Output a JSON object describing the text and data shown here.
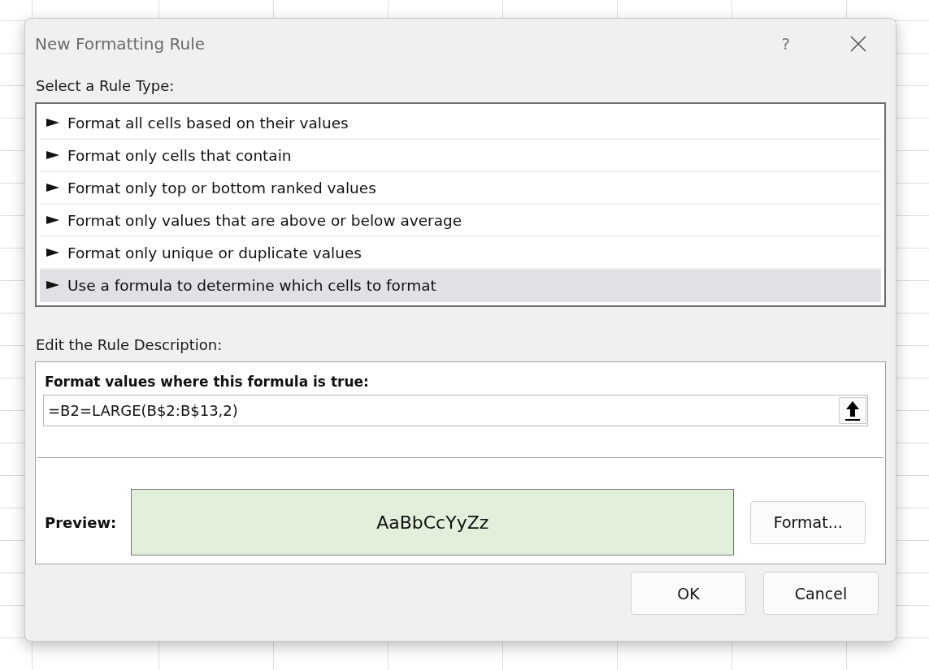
{
  "window": {
    "title": "New Formatting Rule",
    "help": "?"
  },
  "rule_type": {
    "label": "Select a Rule Type:",
    "items": [
      {
        "label": "Format all cells based on their values",
        "selected": false
      },
      {
        "label": "Format only cells that contain",
        "selected": false
      },
      {
        "label": "Format only top or bottom ranked values",
        "selected": false
      },
      {
        "label": "Format only values that are above or below average",
        "selected": false
      },
      {
        "label": "Format only unique or duplicate values",
        "selected": false
      },
      {
        "label": "Use a formula to determine which cells to format",
        "selected": true
      }
    ]
  },
  "description": {
    "label": "Edit the Rule Description:",
    "formula_label": "Format values where this formula is true:",
    "formula": "=B2=LARGE(B$2:B$13,2)",
    "preview_label": "Preview:",
    "preview_text": "AaBbCcYyZz",
    "format_button": "Format..."
  },
  "buttons": [
    "OK",
    "Cancel"
  ]
}
